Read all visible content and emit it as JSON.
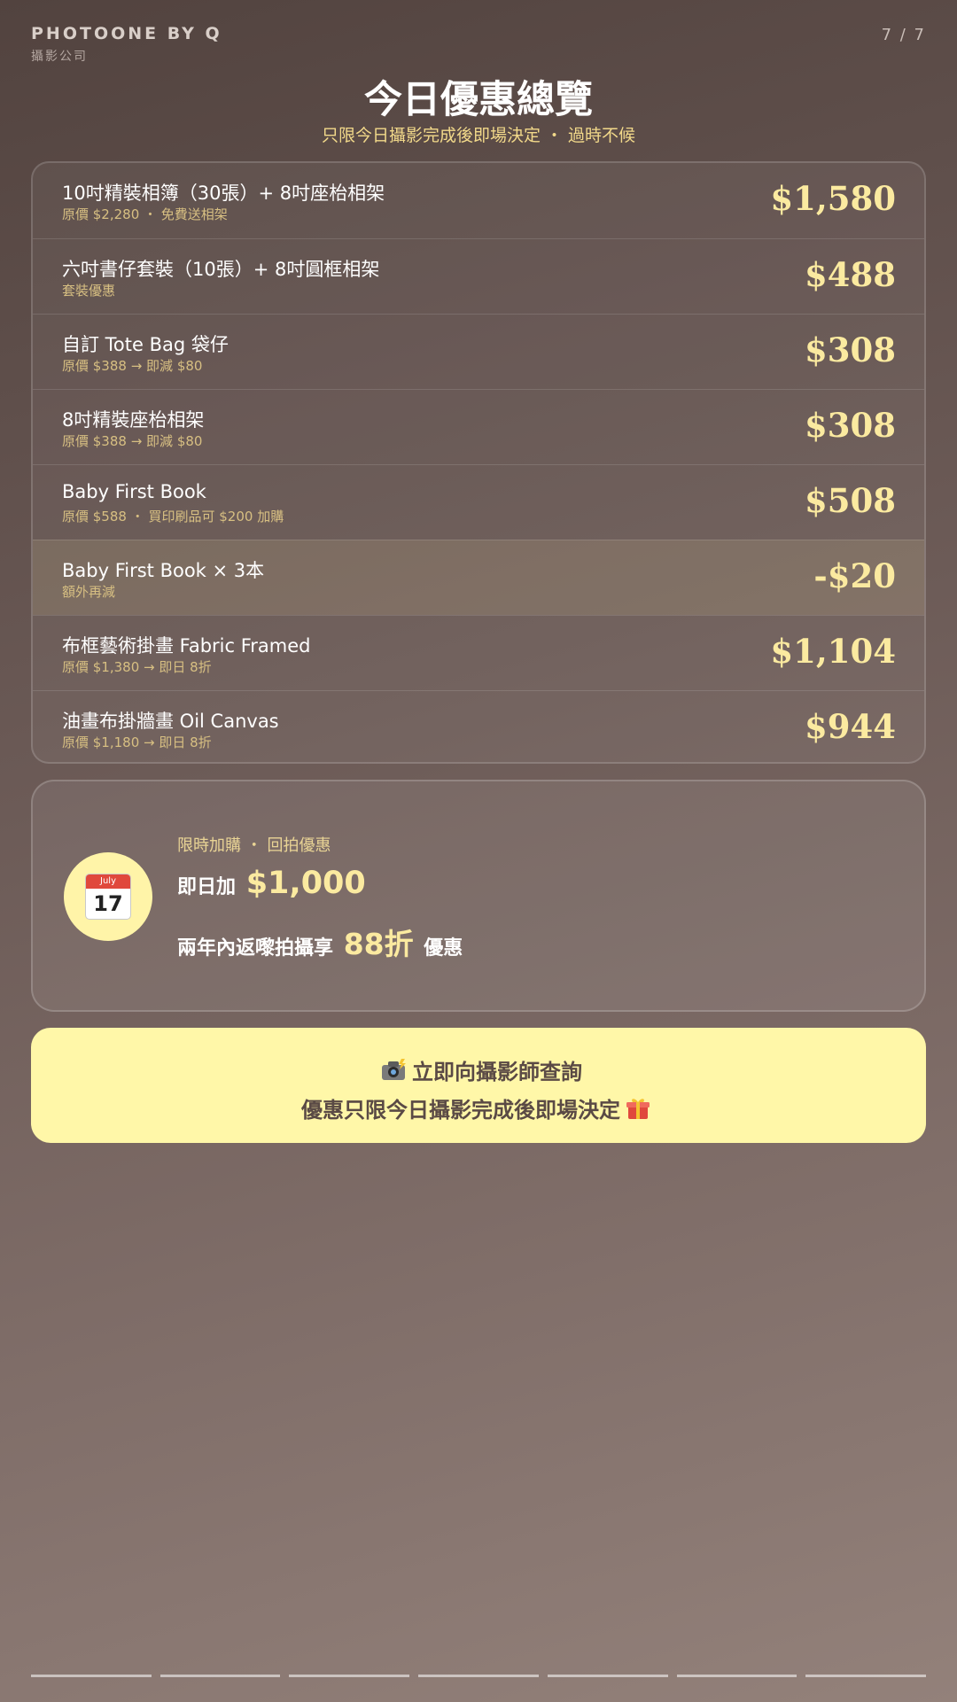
{
  "header": {
    "brand_name": "PHOTOONE BY Q",
    "brand_sub": "攝影公司",
    "page_counter": "7 / 7"
  },
  "title": "今日優惠總覽",
  "subtitle": "只限今日攝影完成後即場決定 ・ 過時不候",
  "offers": [
    {
      "name": "10吋精裝相簿（30張）+ 8吋座枱相架",
      "note": "原價 $2,280 ・ 免費送相架",
      "price": "$1,580",
      "highlight": false
    },
    {
      "name": "六吋書仔套裝（10張）+ 8吋圓框相架",
      "note": "套裝優惠",
      "price": "$488",
      "highlight": false
    },
    {
      "name": "自訂 Tote Bag 袋仔",
      "note": "原價 $388 → 即減 $80",
      "price": "$308",
      "highlight": false
    },
    {
      "name": "8吋精裝座枱相架",
      "note": "原價 $388 → 即減 $80",
      "price": "$308",
      "highlight": false
    },
    {
      "name": "Baby First Book",
      "note": "原價 $588 ・ 買印刷品可 $200 加購",
      "price": "$508",
      "highlight": false
    },
    {
      "name": "Baby First Book × 3本",
      "note": "額外再減",
      "price": "-$20",
      "highlight": true
    },
    {
      "name": "布框藝術掛畫 Fabric Framed",
      "note": "原價 $1,380 → 即日 8折",
      "price": "$1,104",
      "highlight": false
    },
    {
      "name": "油畫布掛牆畫 Oil Canvas",
      "note": "原價 $1,180 → 即日 8折",
      "price": "$944",
      "highlight": false
    }
  ],
  "promo": {
    "icon": "calendar-icon",
    "calendar_month": "July",
    "calendar_day": "17",
    "kicker": "限時加購 ・ 回拍優惠",
    "line1_prefix": "即日加",
    "line1_amount": "$1,000",
    "line2_prefix": "兩年內返嚟拍攝享",
    "line2_discount": "88折",
    "line2_suffix": "優惠"
  },
  "cta": {
    "line1_icon": "camera-flash-icon",
    "line1": "立即向攝影師查詢",
    "line2": "優惠只限今日攝影完成後即場決定",
    "line2_icon": "gift-icon"
  },
  "progress": {
    "total": 7,
    "current": 7
  },
  "colors": {
    "accent": "#fbeaa0",
    "note": "#d7bf82",
    "cta_bg": "#fff7a8",
    "cta_text": "#5a4a45"
  }
}
